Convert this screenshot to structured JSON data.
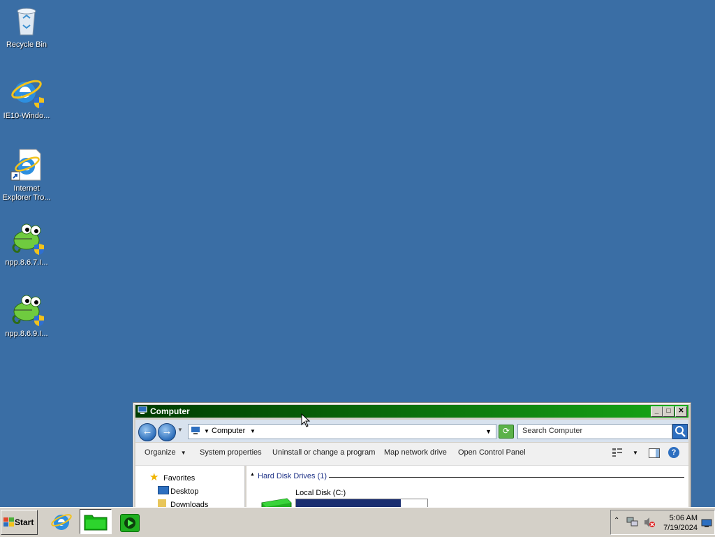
{
  "desktop": {
    "icons": [
      {
        "name": "recycle-bin",
        "label": "Recycle Bin"
      },
      {
        "name": "ie10-installer",
        "label": "IE10-Windo..."
      },
      {
        "name": "ie-troubleshooter",
        "label": "Internet\nExplorer Tro..."
      },
      {
        "name": "npp-867-installer",
        "label": "npp.8.6.7.I..."
      },
      {
        "name": "npp-869-installer",
        "label": "npp.8.6.9.I..."
      }
    ]
  },
  "window": {
    "title": "Computer",
    "address": {
      "crumb": "Computer"
    },
    "search": {
      "placeholder": "Search Computer"
    },
    "toolbar": {
      "organize": "Organize",
      "system_properties": "System properties",
      "uninstall": "Uninstall or change a program",
      "map_drive": "Map network drive",
      "control_panel": "Open Control Panel"
    },
    "nav": {
      "favorites": "Favorites",
      "desktop": "Desktop",
      "downloads": "Downloads"
    },
    "content": {
      "group_header": "Hard Disk Drives (1)",
      "drive_label": "Local Disk (C:)",
      "drive_usage_fraction": 0.8
    }
  },
  "taskbar": {
    "start_label": "Start",
    "clock": {
      "time": "5:06 AM",
      "date": "7/19/2024"
    }
  },
  "colors": {
    "desktop": "#3a6ea5",
    "titlebar_start": "#003c00",
    "titlebar_end": "#17a817",
    "drive_bar": "#1a2e70"
  }
}
